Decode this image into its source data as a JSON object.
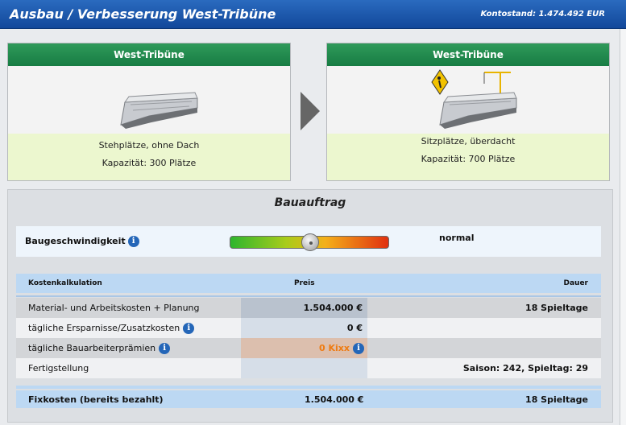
{
  "header": {
    "title": "Ausbau / Verbesserung West-Tribüne",
    "balance": "Kontostand: 1.474.492 EUR"
  },
  "current": {
    "title": "West-Tribüne",
    "image": "stand-without-roof",
    "type": "Stehplätze, ohne Dach",
    "capacity": "Kapazität: 300 Plätze"
  },
  "target": {
    "title": "West-Tribüne",
    "image": "stand-under-construction",
    "type": "Sitzplätze, überdacht",
    "capacity": "Kapazität: 700 Plätze"
  },
  "order": {
    "title": "Bauauftrag",
    "speed_label": "Baugeschwindigkeit",
    "speed_value": "normal",
    "speed_level": 0.5
  },
  "table": {
    "headers": {
      "label": "Kostenkalkulation",
      "price": "Preis",
      "duration": "Dauer"
    },
    "rows": [
      {
        "label": "Material- und Arbeitskosten + Planung",
        "price": "1.504.000 €",
        "duration": "18 Spieltage",
        "info": false
      },
      {
        "label": "tägliche Ersparnisse/Zusatzkosten",
        "price": "0 €",
        "duration": "",
        "info": true
      },
      {
        "label": "tägliche Bauarbeiterprämien",
        "price": "0 Kixx",
        "duration": "",
        "info": true
      },
      {
        "label": "Fertigstellung",
        "price": "",
        "duration": "Saison: 242, Spieltag: 29",
        "info": false
      }
    ],
    "sum": {
      "label": "Fixkosten (bereits bezahlt)",
      "price": "1.504.000 €",
      "duration": "18 Spieltage"
    }
  },
  "colors": {
    "header_blue": "#12489a",
    "card_green": "#177c43",
    "highlight_orange": "#ee7b12"
  }
}
